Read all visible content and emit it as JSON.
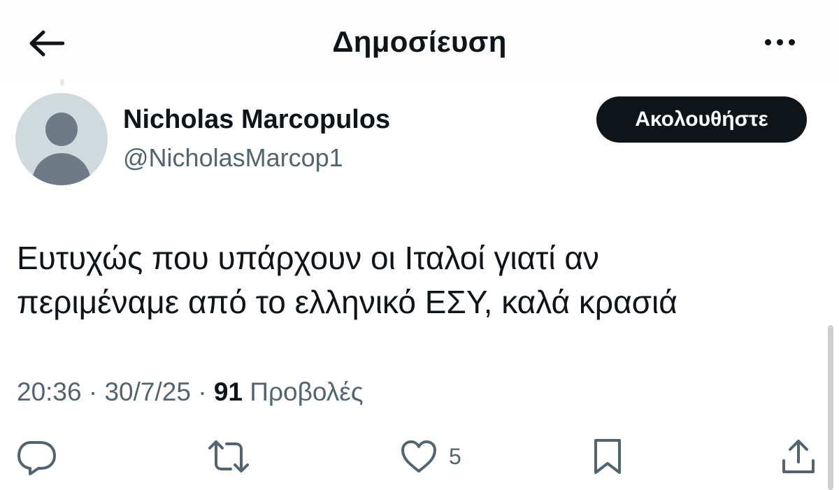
{
  "header": {
    "title": "Δημοσίευση",
    "back_icon": "arrow-left-icon",
    "more_icon": "more-horizontal-icon"
  },
  "author": {
    "name": "Nicholas Marcopulos",
    "handle": "@NicholasMarcop1",
    "follow_label": "Ακολουθήστε"
  },
  "tweet": {
    "lines": [
      "Ευτυχώς που υπάρχουν οι Ιταλοί γιατί αν",
      "περιμέναμε από το ελληνικό ΕΣΥ, καλά κρασιά"
    ],
    "time": "20:36",
    "sep1": " · ",
    "date": "30/7/25",
    "sep2": " · ",
    "views_count": "91",
    "views_label": " Προβολές"
  },
  "actions": {
    "reply_icon": "reply-bubble-icon",
    "retweet_icon": "retweet-icon",
    "like_icon": "heart-icon",
    "like_count": "5",
    "bookmark_icon": "bookmark-icon",
    "share_icon": "share-icon"
  },
  "colors": {
    "text": "#0f1419",
    "secondary": "#536471",
    "follow_bg": "#0f1419"
  }
}
